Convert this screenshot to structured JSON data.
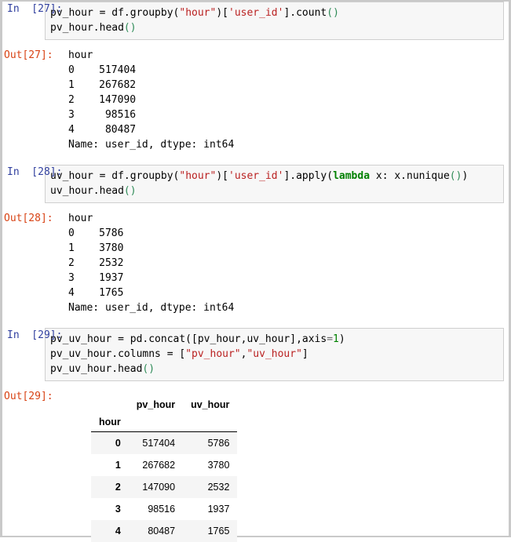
{
  "notebook": {
    "cells": [
      {
        "id": "cell-27",
        "prompt_in": "In  [27]:",
        "prompt_out": "Out[27]:",
        "code_lines": [
          "pv_hour = df.groupby(\"hour\")['user_id'].count()",
          "pv_hour.head()"
        ],
        "output_type": "text",
        "output_text": "hour\n0    517404\n1    267682\n2    147090\n3     98516\n4     80487\nName: user_id, dtype: int64"
      },
      {
        "id": "cell-28",
        "prompt_in": "In  [28]:",
        "prompt_out": "Out[28]:",
        "code_lines": [
          "uv_hour = df.groupby(\"hour\")['user_id'].apply(lambda x: x.nunique())",
          "uv_hour.head()"
        ],
        "output_type": "text",
        "output_text": "hour\n0    5786\n1    3780\n2    2532\n3    1937\n4    1765\nName: user_id, dtype: int64"
      },
      {
        "id": "cell-29",
        "prompt_in": "In  [29]:",
        "prompt_out": "Out[29]:",
        "code_lines": [
          "pv_uv_hour = pd.concat([pv_hour,uv_hour],axis=1)",
          "pv_uv_hour.columns = [\"pv_hour\",\"uv_hour\"]",
          "pv_uv_hour.head()"
        ],
        "output_type": "dataframe"
      }
    ]
  },
  "dataframe": {
    "index_name": "hour",
    "columns": [
      "pv_hour",
      "uv_hour"
    ],
    "index": [
      "0",
      "1",
      "2",
      "3",
      "4"
    ],
    "rows": [
      [
        "517404",
        "5786"
      ],
      [
        "267682",
        "3780"
      ],
      [
        "147090",
        "2532"
      ],
      [
        "98516",
        "1937"
      ],
      [
        "80487",
        "1765"
      ]
    ]
  },
  "colors": {
    "prompt_in": "#303f9f",
    "prompt_out": "#d84315",
    "string": "#ba2121",
    "keyword": "#008000",
    "input_bg": "#f7f7f7",
    "input_border": "#cfcfcf",
    "frame_border": "#c9c9c9",
    "row_stripe": "#f5f5f5"
  }
}
